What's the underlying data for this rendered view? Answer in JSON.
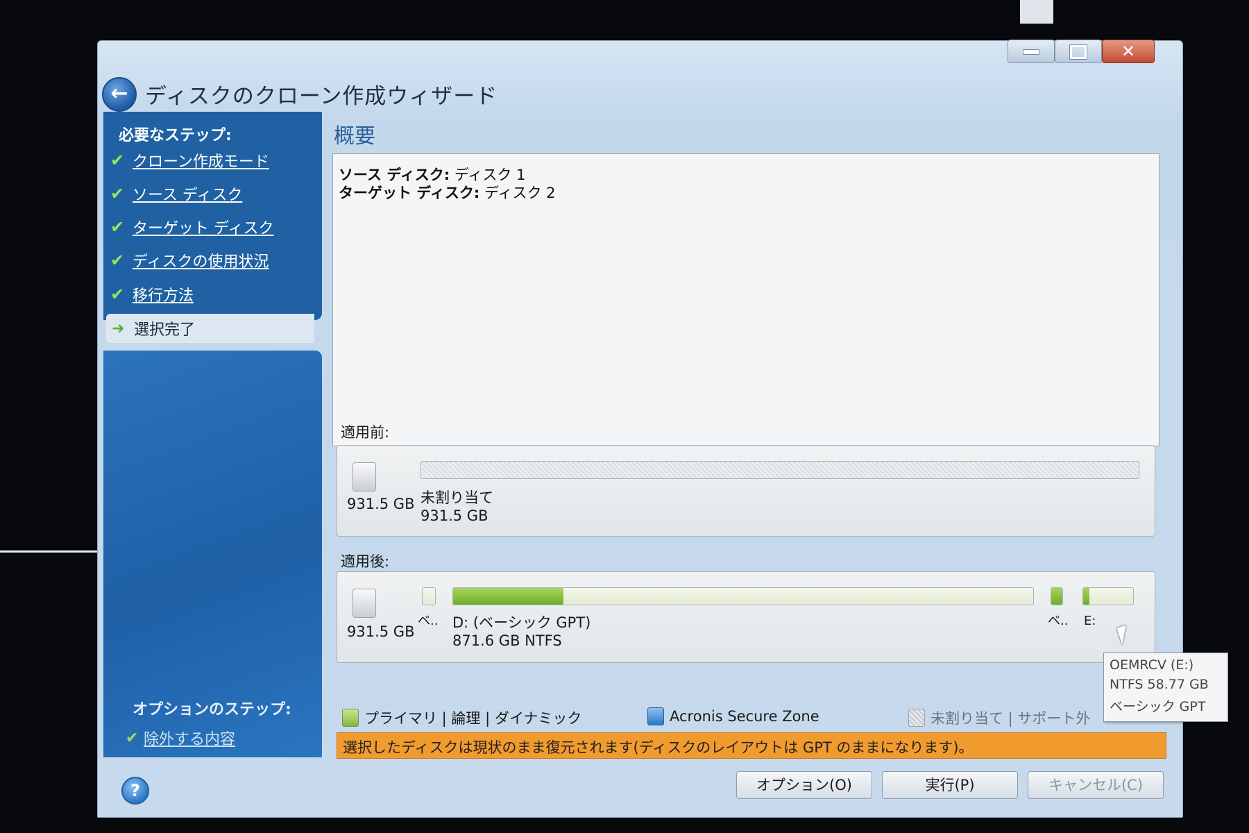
{
  "window": {
    "title": "ディスクのクローン作成ウィザード",
    "controls": {
      "minimize": "minimize",
      "maximize": "maximize",
      "close": "✕"
    }
  },
  "sidebar": {
    "required_heading": "必要なステップ:",
    "steps": [
      {
        "label": "クローン作成モード",
        "state": "done"
      },
      {
        "label": "ソース ディスク",
        "state": "done"
      },
      {
        "label": "ターゲット ディスク",
        "state": "done"
      },
      {
        "label": "ディスクの使用状況",
        "state": "done"
      },
      {
        "label": "移行方法",
        "state": "done"
      },
      {
        "label": "選択完了",
        "state": "current"
      }
    ],
    "optional_heading": "オプションのステップ:",
    "optional_steps": [
      {
        "label": "除外する内容",
        "state": "done"
      }
    ]
  },
  "main": {
    "heading": "概要",
    "summary": {
      "source_label": "ソース ディスク:",
      "source_value": "ディスク 1",
      "target_label": "ターゲット ディスク:",
      "target_value": "ディスク 2"
    },
    "before": {
      "label": "適用前:",
      "disk_size": "931.5 GB",
      "partition_name": "未割り当て",
      "partition_size": "931.5 GB"
    },
    "after": {
      "label": "適用後:",
      "disk_size": "931.5 GB",
      "small_part_label": "ベ..",
      "main_part_name": "D: (ベーシック GPT)",
      "main_part_detail": "871.6 GB  NTFS",
      "main_part_fill": 0.19,
      "right_small_label": "ベ..",
      "e_part_label": "E:"
    },
    "legend": {
      "primary": "プライマリ | 論理 | ダイナミック",
      "secure_zone": "Acronis Secure Zone",
      "unallocated": "未割り当て | サポート外"
    },
    "warning": "選択したディスクは現状のまま復元されます(ディスクのレイアウトは GPT のままになります)。",
    "tooltip": {
      "line1": "OEMRCV (E:)",
      "line2": "NTFS 58.77 GB",
      "line3": "ベーシック GPT"
    }
  },
  "buttons": {
    "help": "?",
    "options": "オプション(O)",
    "execute": "実行(P)",
    "cancel": "キャンセル(C)"
  },
  "colors": {
    "sidebar": "#1f61a3",
    "accent_green": "#6fae25",
    "warning": "#f19a2e"
  }
}
